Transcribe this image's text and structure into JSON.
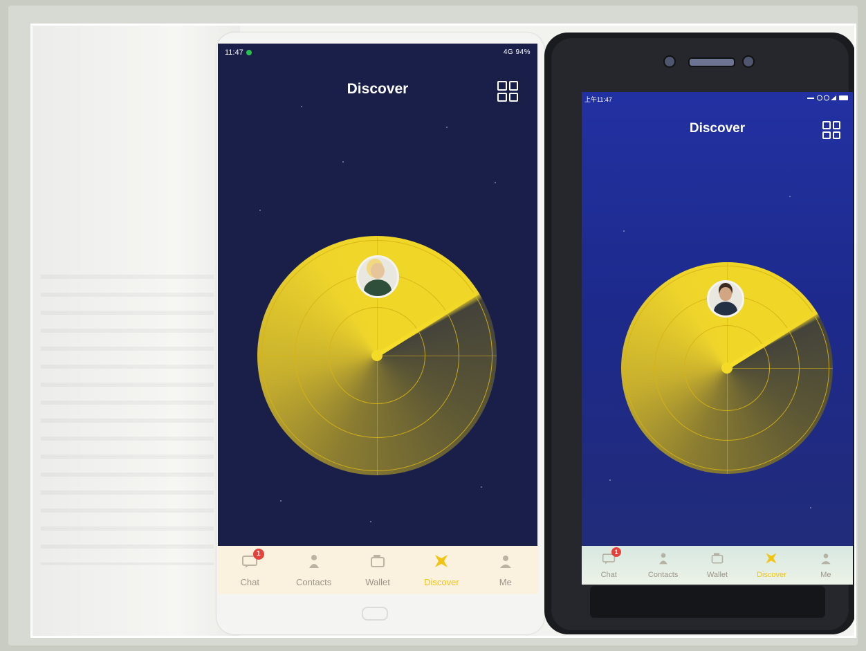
{
  "phone_left": {
    "status": {
      "time": "11:47",
      "indicators": "4G 94%"
    },
    "title": "Discover",
    "corner_icon": "grid-icon",
    "tabs": [
      {
        "label": "Chat",
        "icon": "chat-icon",
        "badge": "1",
        "active": false
      },
      {
        "label": "Contacts",
        "icon": "contacts-icon",
        "active": false
      },
      {
        "label": "Wallet",
        "icon": "wallet-icon",
        "active": false
      },
      {
        "label": "Discover",
        "icon": "discover-icon",
        "active": true
      },
      {
        "label": "Me",
        "icon": "me-icon",
        "active": false
      }
    ]
  },
  "phone_right": {
    "status": {
      "time": "上午11:47"
    },
    "title": "Discover",
    "corner_icon": "grid-icon",
    "tabs": [
      {
        "label": "Chat",
        "icon": "chat-icon",
        "badge": "1",
        "active": false
      },
      {
        "label": "Contacts",
        "icon": "contacts-icon",
        "active": false
      },
      {
        "label": "Wallet",
        "icon": "wallet-icon",
        "active": false
      },
      {
        "label": "Discover",
        "icon": "discover-icon",
        "active": true
      },
      {
        "label": "Me",
        "icon": "me-icon",
        "active": false
      }
    ]
  },
  "colors": {
    "radar": "#f0d627",
    "screen_left_bg": "#1a1f4a",
    "screen_right_bg": "#1f2c90",
    "active_tab": "#f1c414",
    "badge": "#e2433a"
  }
}
